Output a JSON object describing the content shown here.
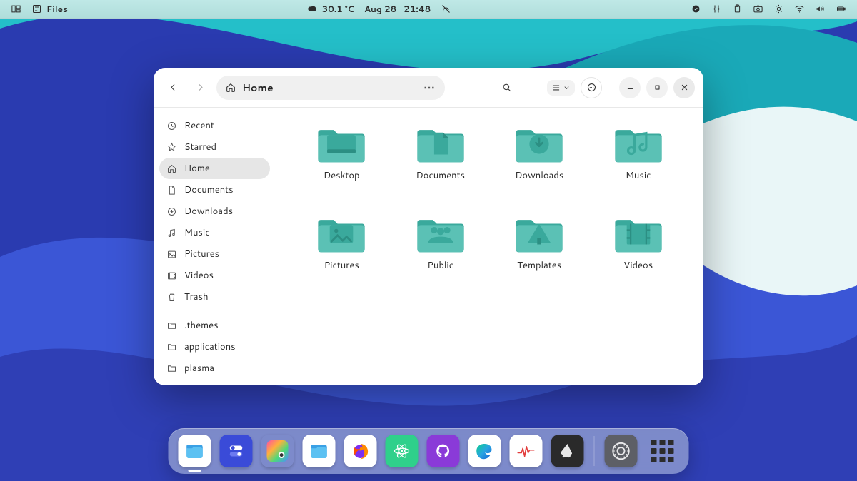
{
  "panel": {
    "app_label": "Files",
    "temperature": "30.1 °C",
    "date": "Aug 28",
    "time": "21:48"
  },
  "window": {
    "path_label": "Home"
  },
  "sidebar": {
    "items": [
      {
        "icon": "clock",
        "label": "Recent"
      },
      {
        "icon": "star",
        "label": "Starred"
      },
      {
        "icon": "home",
        "label": "Home",
        "active": true
      },
      {
        "icon": "doc",
        "label": "Documents"
      },
      {
        "icon": "download",
        "label": "Downloads"
      },
      {
        "icon": "music",
        "label": "Music"
      },
      {
        "icon": "image",
        "label": "Pictures"
      },
      {
        "icon": "video",
        "label": "Videos"
      },
      {
        "icon": "trash",
        "label": "Trash"
      }
    ],
    "user_dirs": [
      {
        "label": ".themes"
      },
      {
        "label": "applications"
      },
      {
        "label": "plasma"
      }
    ]
  },
  "folders": [
    {
      "label": "Desktop",
      "glyph": "desktop"
    },
    {
      "label": "Documents",
      "glyph": "doc"
    },
    {
      "label": "Downloads",
      "glyph": "download"
    },
    {
      "label": "Music",
      "glyph": "music"
    },
    {
      "label": "Pictures",
      "glyph": "image"
    },
    {
      "label": "Public",
      "glyph": "people"
    },
    {
      "label": "Templates",
      "glyph": "template"
    },
    {
      "label": "Videos",
      "glyph": "video"
    }
  ],
  "dock": [
    {
      "name": "files",
      "color": "#ffffff",
      "active": true
    },
    {
      "name": "tweaks",
      "color": "#3a4bd8"
    },
    {
      "name": "colors",
      "color": "linear"
    },
    {
      "name": "files2",
      "color": "#ffffff"
    },
    {
      "name": "firefox",
      "color": "#ffffff"
    },
    {
      "name": "atom",
      "color": "#2fd08b"
    },
    {
      "name": "github",
      "color": "#8a3ad8"
    },
    {
      "name": "edge",
      "color": "#ffffff"
    },
    {
      "name": "monitor",
      "color": "#ffffff"
    },
    {
      "name": "inkscape",
      "color": "#2a2a2a"
    }
  ],
  "theme": {
    "folder_base": "#5bc1b5",
    "folder_dark": "#3aa99c",
    "folder_glyph": "#2c8f83"
  }
}
